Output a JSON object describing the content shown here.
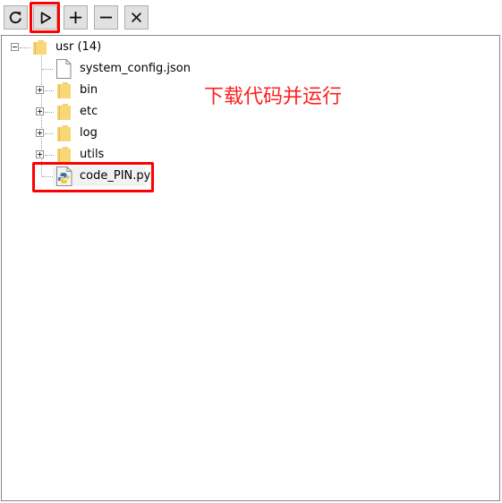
{
  "toolbar": {
    "buttons": [
      {
        "name": "refresh",
        "icon": "refresh-icon"
      },
      {
        "name": "run",
        "icon": "play-icon"
      },
      {
        "name": "add",
        "icon": "plus-icon"
      },
      {
        "name": "remove",
        "icon": "minus-icon"
      },
      {
        "name": "close",
        "icon": "close-icon"
      }
    ]
  },
  "tree": {
    "root": {
      "label": "usr (14)",
      "icon": "folder-icon",
      "expanded": true
    },
    "children": [
      {
        "label": "system_config.json",
        "icon": "file-icon",
        "expandable": false
      },
      {
        "label": "bin",
        "icon": "folder-icon",
        "expandable": true
      },
      {
        "label": "etc",
        "icon": "folder-icon",
        "expandable": true
      },
      {
        "label": "log",
        "icon": "folder-icon",
        "expandable": true
      },
      {
        "label": "utils",
        "icon": "folder-icon",
        "expandable": true
      },
      {
        "label": "code_PIN.py",
        "icon": "python-file-icon",
        "expandable": false,
        "selected": true
      }
    ]
  },
  "annotation": {
    "text": "下载代码并运行",
    "color": "#ff2020"
  },
  "colors": {
    "highlight": "#ff0000",
    "folder": "#f5d07a",
    "button_bg": "#e1e1e1"
  }
}
